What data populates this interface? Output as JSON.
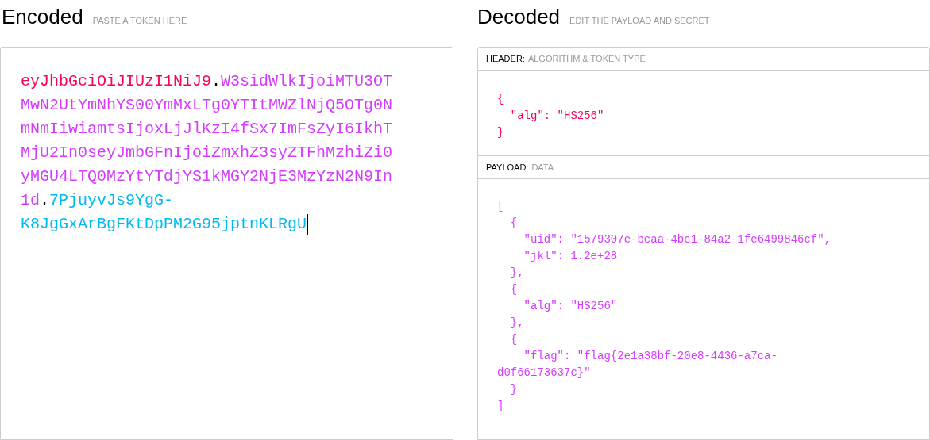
{
  "encoded": {
    "title": "Encoded",
    "hint": "PASTE A TOKEN HERE",
    "lines": [
      [
        {
          "kind": "header",
          "text": "eyJhbGciOiJIUzI1NiJ9"
        },
        {
          "kind": "dot",
          "text": "."
        },
        {
          "kind": "payload",
          "text": "W3sidWlkIjoiMTU3OT"
        }
      ],
      [
        {
          "kind": "payload",
          "text": "MwN2UtYmNhYS00YmMxLTg0YTItMWZlNjQ5OTg0N"
        }
      ],
      [
        {
          "kind": "payload",
          "text": "mNmIiwiamtsIjoxLjJlKzI4fSx7ImFsZyI6IkhT"
        }
      ],
      [
        {
          "kind": "payload",
          "text": "MjU2In0seyJmbGFnIjoiZmxhZ3syZTFhMzhiZi0"
        }
      ],
      [
        {
          "kind": "payload",
          "text": "yMGU4LTQ0MzYtYTdjYS1kMGY2NjE3MzYzN2N9In"
        }
      ],
      [
        {
          "kind": "payload",
          "text": "1d"
        },
        {
          "kind": "dot",
          "text": "."
        },
        {
          "kind": "signature",
          "text": "7PjuyvJs9YgG-"
        }
      ],
      [
        {
          "kind": "signature",
          "text": "K8JgGxArBgFKtDpPM2G95jptnKLRgU"
        }
      ]
    ]
  },
  "decoded": {
    "title": "Decoded",
    "hint": "EDIT THE PAYLOAD AND SECRET",
    "sections": [
      {
        "kind": "header",
        "label": "HEADER:",
        "sublabel": "ALGORITHM & TOKEN TYPE",
        "lines": [
          "{",
          "  \"alg\": \"HS256\"",
          "}"
        ]
      },
      {
        "kind": "payload",
        "label": "PAYLOAD:",
        "sublabel": "DATA",
        "lines": [
          "[",
          "  {",
          "    \"uid\": \"1579307e-bcaa-4bc1-84a2-1fe6499846cf\",",
          "    \"jkl\": 1.2e+28",
          "  },",
          "  {",
          "    \"alg\": \"HS256\"",
          "  },",
          "  {",
          "    \"flag\": \"flag{2e1a38bf-20e8-4436-a7ca-",
          "d0f66173637c}\"",
          "  }",
          "]"
        ]
      }
    ]
  }
}
